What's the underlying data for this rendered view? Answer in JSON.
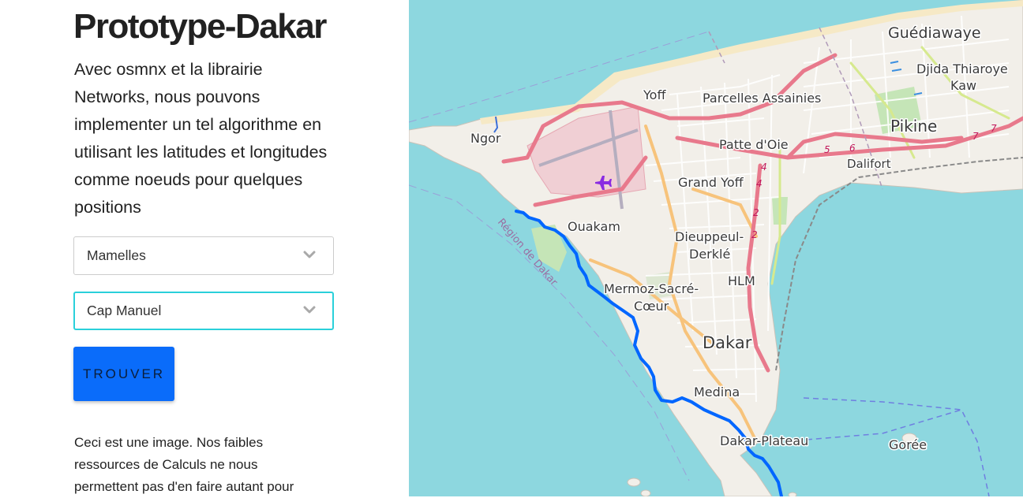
{
  "header": {
    "title": "Prototype-Dakar"
  },
  "intro": {
    "text": "Avec osmnx et la librairie Networks, nous pouvons implementer un tel algorithme en utilisant les latitudes et longitudes comme noeuds pour quelques positions"
  },
  "form": {
    "origin": {
      "selected": "Mamelles"
    },
    "destination": {
      "selected": "Cap Manuel"
    },
    "submit_label": "TROUVER"
  },
  "note": {
    "text": "Ceci est une image. Nos faibles ressources de Calculs ne nous permettent pas d'en faire autant pour"
  },
  "map": {
    "labels": {
      "guediawaye": "Guédiawaye",
      "djida": "Djida Thiaroye",
      "kaw": "Kaw",
      "yoff": "Yoff",
      "parcelles": "Parcelles Assainies",
      "pikine": "Pikine",
      "ngor": "Ngor",
      "patte_doie": "Patte d'Oie",
      "dalifort": "Dalifort",
      "grand_yoff": "Grand Yoff",
      "ouakam": "Ouakam",
      "dieuppeul": "Dieuppeul-",
      "derkle": "Derklé",
      "hlm": "HLM",
      "mermoz": "Mermoz-Sacré-",
      "coeur": "Cœur",
      "dakar": "Dakar",
      "medina": "Medina",
      "dakar_plateau": "Dakar-Plateau",
      "goree": "Gorée",
      "region": "Région de Dakar"
    },
    "route_numbers": [
      "5",
      "6",
      "7",
      "7",
      "4",
      "4",
      "2",
      "2"
    ],
    "colors": {
      "sea": "#8dd7df",
      "land": "#f2efe9",
      "route": "#0066ff",
      "primary_road": "#e8798c",
      "secondary_road": "#f7c37b",
      "airport": "#f0cfd4",
      "accent_border": "#2ad0da",
      "button": "#0a6cfa"
    }
  }
}
